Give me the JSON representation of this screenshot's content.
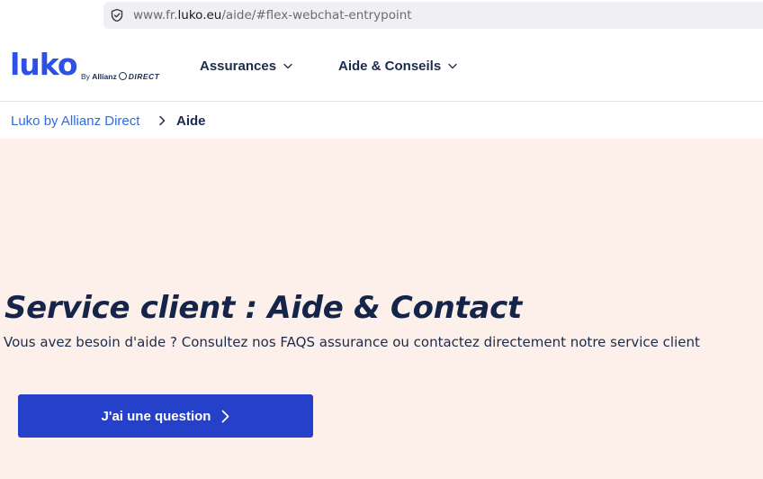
{
  "browser": {
    "url_prefix": "www.fr.",
    "url_domain": "luko.eu",
    "url_path": "/aide/#flex-webchat-entrypoint",
    "security_icon": "shield-icon"
  },
  "header": {
    "logo_text": "luko",
    "byline_by": "By",
    "byline_allianz": "Allianz",
    "byline_direct": "DIRECT",
    "nav": [
      {
        "label": "Assurances",
        "icon": "chevron-down-icon"
      },
      {
        "label": "Aide & Conseils",
        "icon": "chevron-down-icon"
      }
    ]
  },
  "breadcrumb": {
    "parent": "Luko by Allianz Direct",
    "current": "Aide",
    "separator_icon": "chevron-right-icon"
  },
  "hero": {
    "title": "Service client : Aide & Contact",
    "description": "Vous avez besoin d'aide ? Consultez nos FAQS assurance ou contactez  directement notre service client",
    "cta_label": "J'ai une question",
    "cta_icon": "chevron-right-icon"
  },
  "colors": {
    "brand_blue": "#2d50e6",
    "cta_blue": "#2540c9",
    "hero_bg": "#fdf0ea",
    "navy_text": "#1b2b4d",
    "link_blue": "#2d6cdf"
  }
}
